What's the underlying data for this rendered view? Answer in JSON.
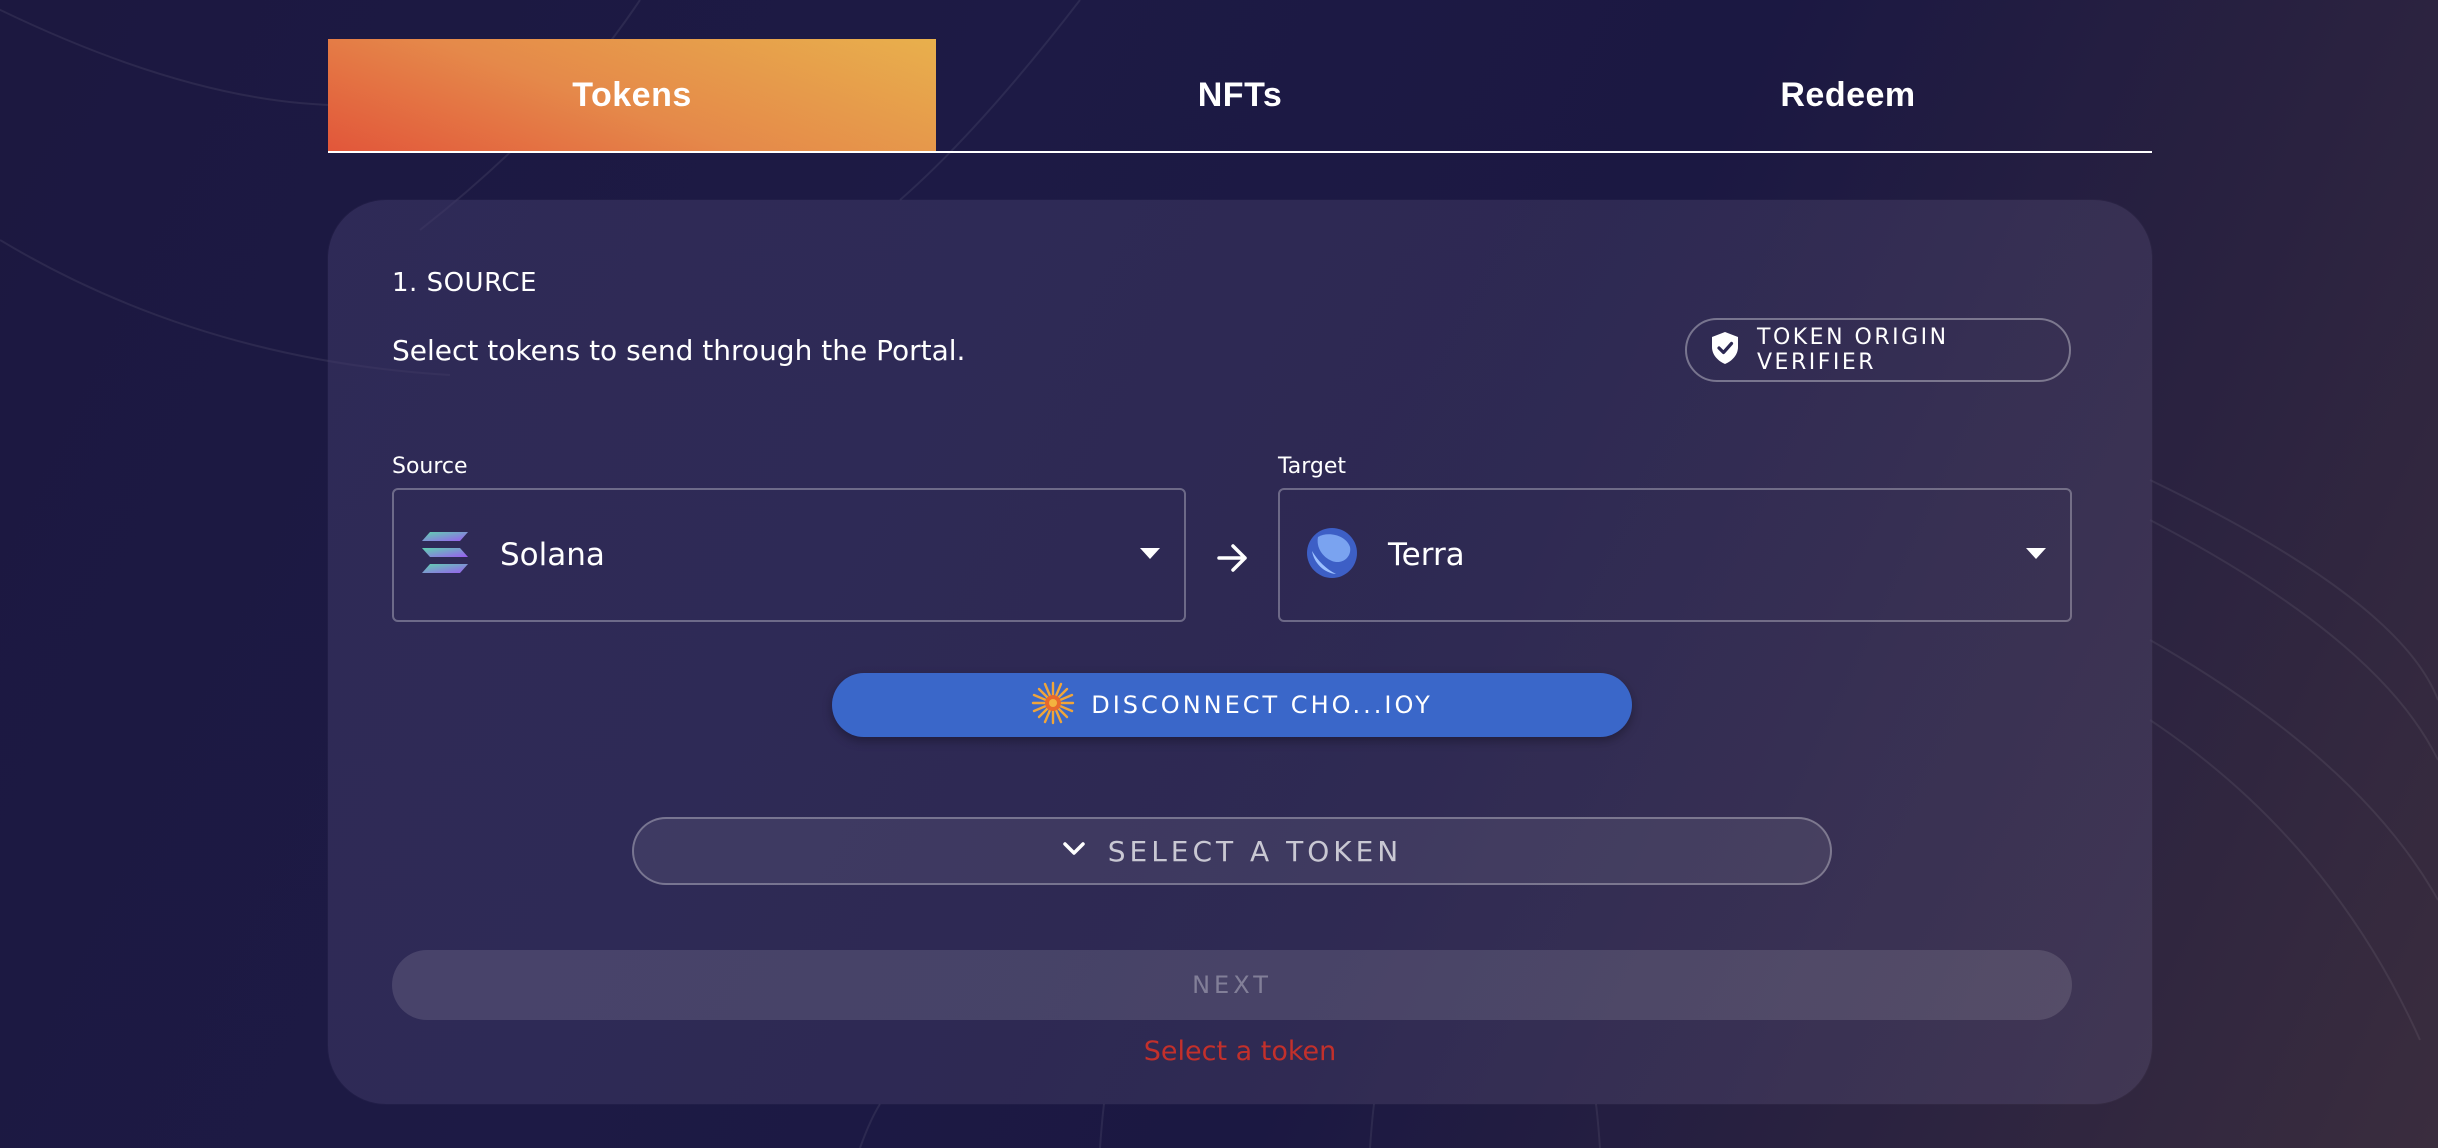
{
  "tabs": [
    {
      "label": "Tokens",
      "active": true
    },
    {
      "label": "NFTs",
      "active": false
    },
    {
      "label": "Redeem",
      "active": false
    }
  ],
  "card": {
    "section_title": "1. SOURCE",
    "description": "Select tokens to send through the Portal.",
    "verifier_button": {
      "label": "TOKEN ORIGIN VERIFIER",
      "icon": "shield-check-icon"
    },
    "source": {
      "label": "Source",
      "value": "Solana",
      "icon": "solana-icon"
    },
    "target": {
      "label": "Target",
      "value": "Terra",
      "icon": "terra-icon"
    },
    "swap_icon": "arrow-right-icon",
    "disconnect_button": {
      "label": "DISCONNECT CHO...IOY",
      "icon": "wallet-sun-icon"
    },
    "select_token_button": {
      "label": "SELECT A TOKEN",
      "icon": "chevron-down-icon"
    },
    "next_button": {
      "label": "NEXT",
      "enabled": false
    },
    "error_text": "Select a token"
  },
  "colors": {
    "accent_blue": "#3a67c9",
    "tab_gradient_start": "#e2563a",
    "tab_gradient_end": "#e8b04c",
    "error": "#c3302b"
  }
}
